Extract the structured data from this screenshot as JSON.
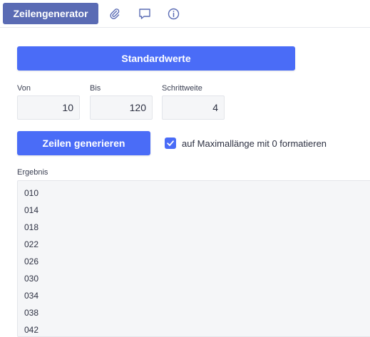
{
  "tabs": {
    "active_label": "Zeilengenerator",
    "icons": [
      "paperclip-icon",
      "comment-icon",
      "info-icon"
    ]
  },
  "defaults_button": "Standardwerte",
  "fields": {
    "from": {
      "label": "Von",
      "value": "10"
    },
    "to": {
      "label": "Bis",
      "value": "120"
    },
    "step": {
      "label": "Schrittweite",
      "value": "4"
    }
  },
  "generate_button": "Zeilen generieren",
  "pad_option": {
    "label": "auf Maximallänge mit 0 formatieren",
    "checked": true
  },
  "result": {
    "label": "Ergebnis",
    "lines": [
      "010",
      "014",
      "018",
      "022",
      "026",
      "030",
      "034",
      "038",
      "042"
    ]
  },
  "colors": {
    "accent": "#4a6cf7",
    "tab_active": "#5a6bb4"
  }
}
